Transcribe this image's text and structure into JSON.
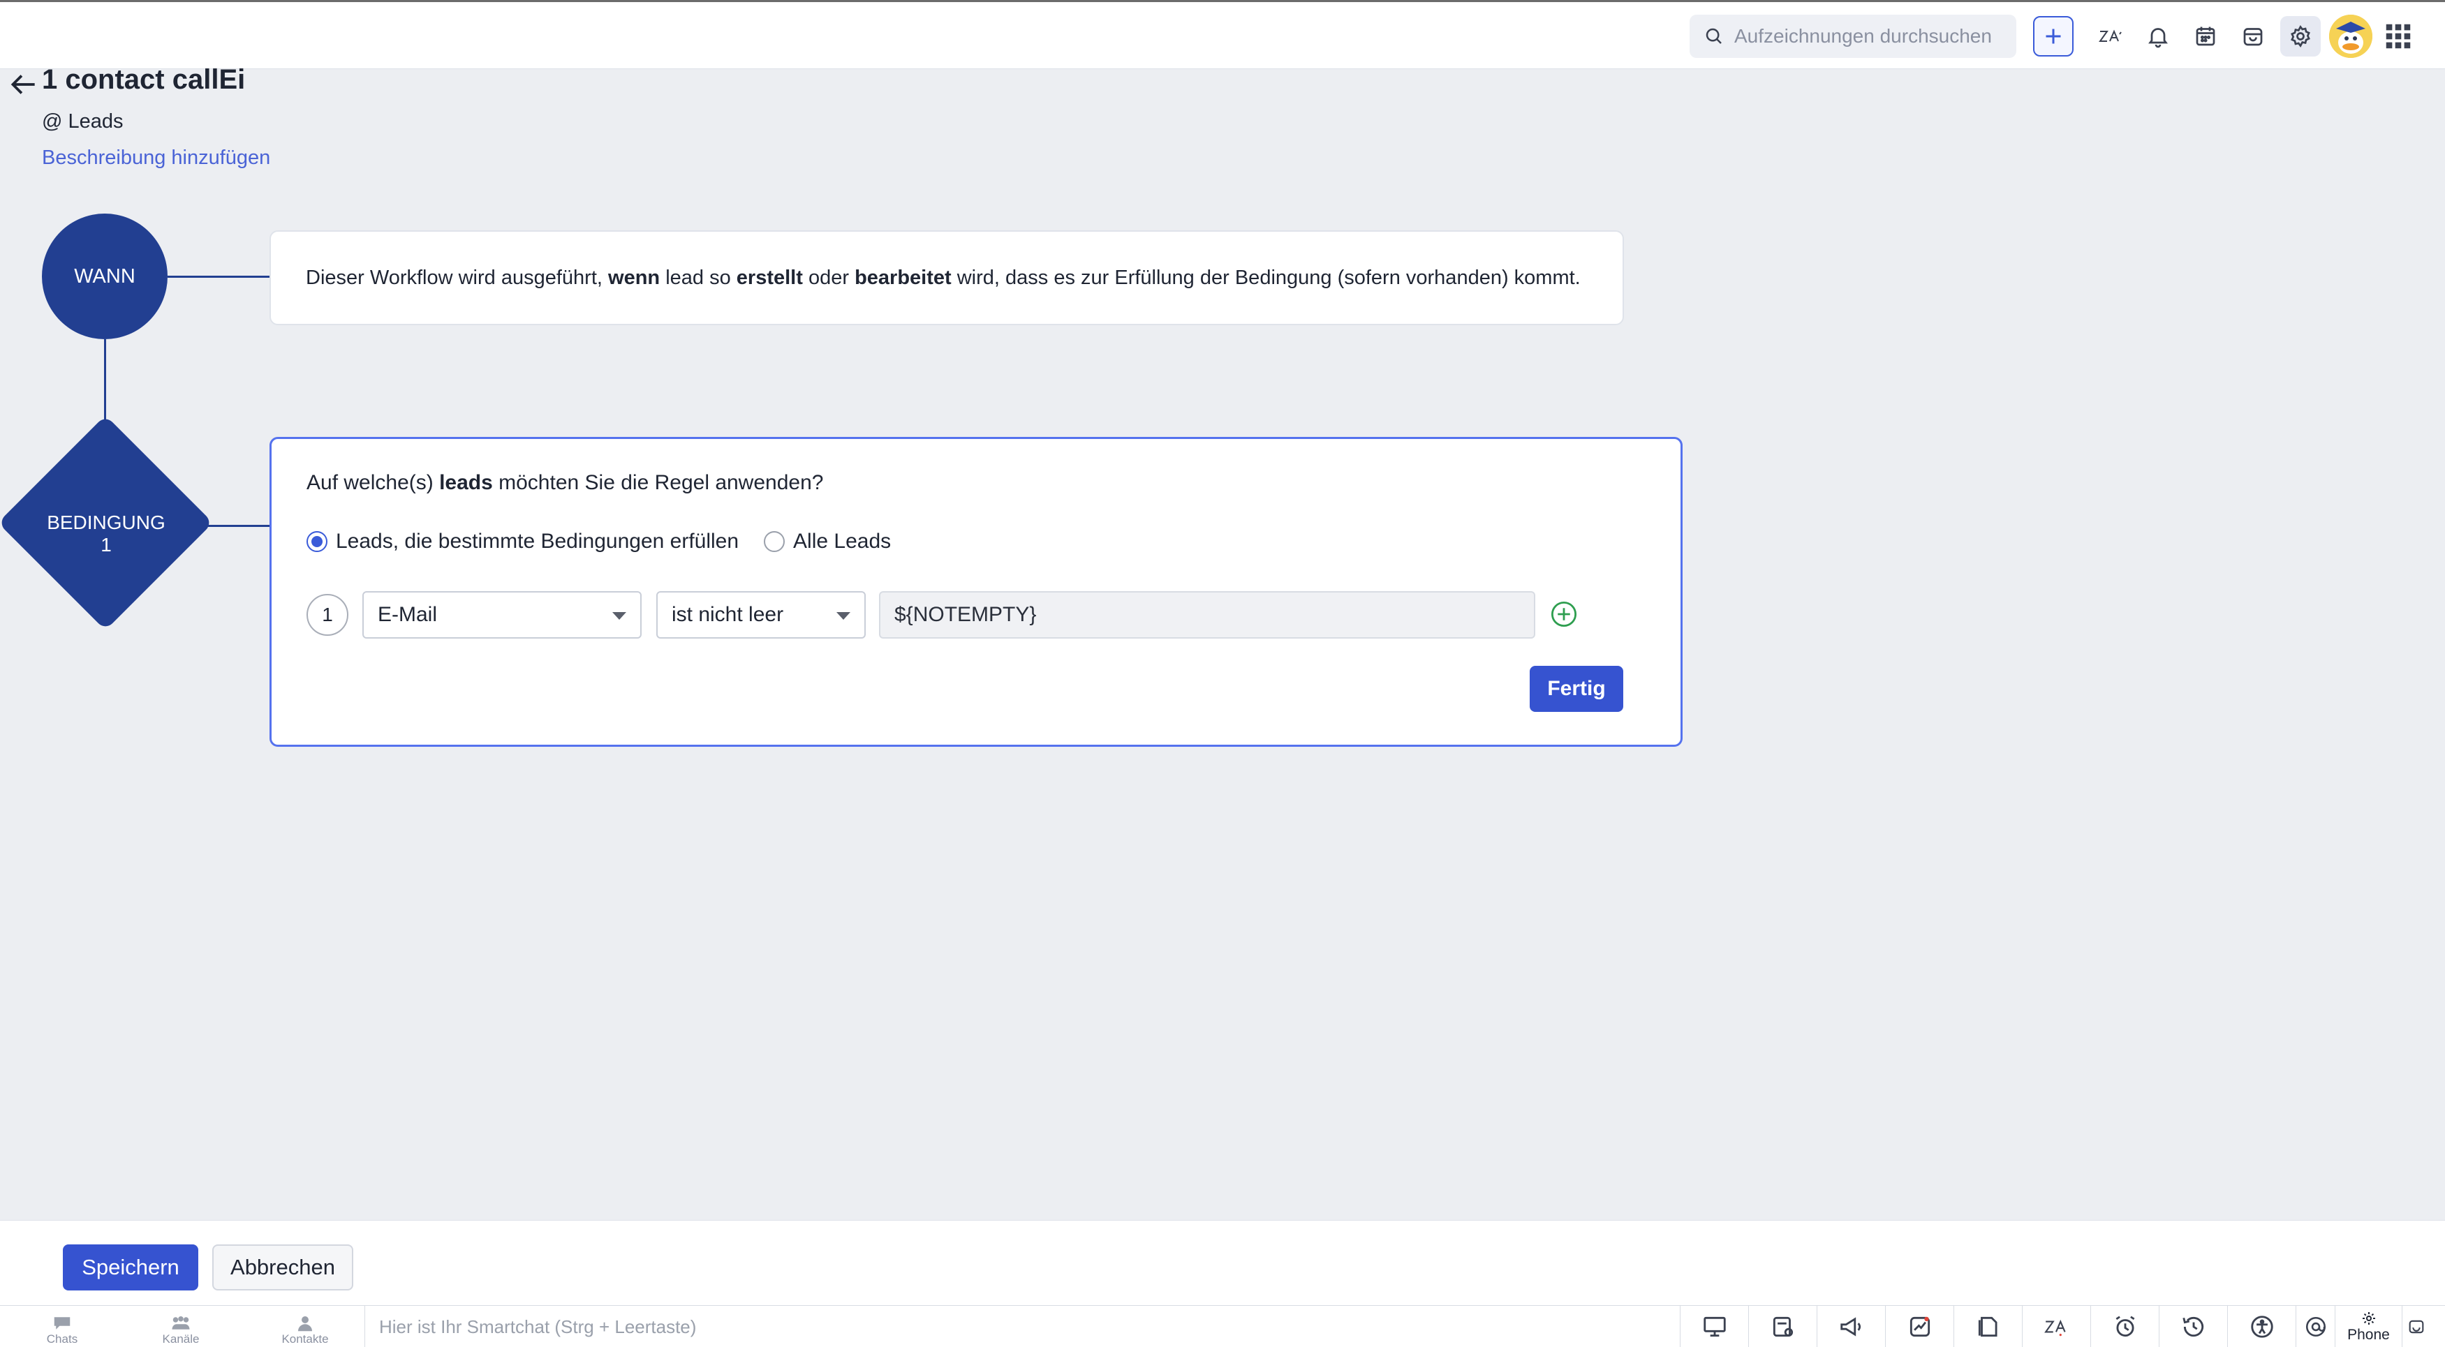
{
  "header": {
    "search_placeholder": "Aufzeichnungen durchsuchen",
    "icons": [
      "search-icon",
      "plus-icon",
      "zia-icon",
      "bell-icon",
      "calendar-icon",
      "marketplace-icon",
      "gear-icon",
      "avatar",
      "apps-grid-icon"
    ]
  },
  "workflow": {
    "title": "1 contact callEi",
    "module": "@ Leads",
    "add_description": "Beschreibung hinzufügen"
  },
  "when_node": {
    "label": "WANN",
    "text_1": "Dieser Workflow wird ausgeführt, ",
    "text_bold_1": "wenn",
    "text_2": " lead so ",
    "text_bold_2": "erstellt",
    "text_3": " oder ",
    "text_bold_3": "bearbeitet",
    "text_4": " wird, dass es zur Erfüllung der Bedingung (sofern vorhanden) kommt."
  },
  "condition_node": {
    "label_line1": "BEDINGUNG",
    "label_line2": "1",
    "question_prefix": "Auf welche(s) ",
    "question_bold": "leads",
    "question_suffix": " möchten Sie die Regel anwenden?",
    "radio_options": [
      {
        "label": "Leads, die bestimmte Bedingungen erfüllen",
        "selected": true
      },
      {
        "label": "Alle Leads",
        "selected": false
      }
    ],
    "criteria": {
      "number": "1",
      "field": "E-Mail",
      "operator": "ist nicht leer",
      "value": "${NOTEMPTY}"
    },
    "done_label": "Fertig"
  },
  "footer": {
    "save_label": "Speichern",
    "cancel_label": "Abbrechen"
  },
  "bottom_bar": {
    "chats": "Chats",
    "channels": "Kanäle",
    "contacts": "Kontakte",
    "smartchat_placeholder": "Hier ist Ihr Smartchat (Strg + Leertaste)",
    "phone": "Phone"
  },
  "colors": {
    "node_blue": "#223f91",
    "accent": "#3653d0",
    "card_border_active": "#5572ee"
  }
}
